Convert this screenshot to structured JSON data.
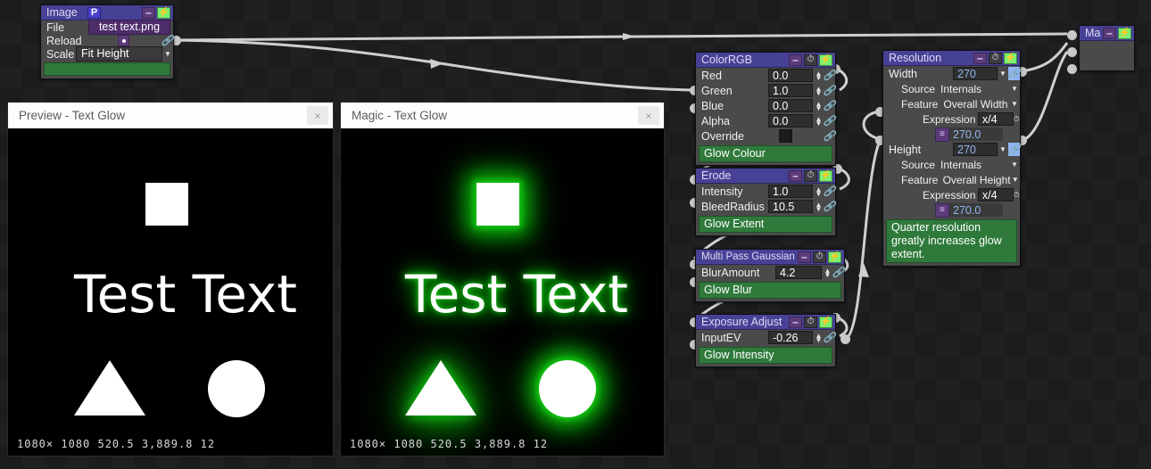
{
  "app": {
    "background_checker": "#1b1c1e"
  },
  "colors": {
    "node_header": "#474196",
    "node_body": "#4a4a4a",
    "comment_green": "#2f7a3b",
    "glow_green": "#12c312",
    "accent_purple": "#5b3b7a",
    "bolt_green": "#79f173",
    "link_active_blue": "#8fb4f2",
    "value_blue": "#93b7ef"
  },
  "nodes": {
    "image": {
      "title": "Image",
      "badge": "P",
      "header_buttons": [
        "minus",
        "bolt"
      ],
      "rows": [
        {
          "label": "File",
          "value": "test text.png",
          "type": "file"
        },
        {
          "label": "Reload",
          "value": "",
          "type": "radio"
        },
        {
          "label": "Scale",
          "value": "Fit Height",
          "type": "select"
        }
      ],
      "comment": ""
    },
    "colorrgb": {
      "title": "ColorRGB",
      "header_buttons": [
        "minus",
        "clock",
        "bolt"
      ],
      "rows": [
        {
          "label": "Red",
          "value": "0.0"
        },
        {
          "label": "Green",
          "value": "1.0"
        },
        {
          "label": "Blue",
          "value": "0.0"
        },
        {
          "label": "Alpha",
          "value": "0.0"
        },
        {
          "label": "Override",
          "value": "",
          "type": "checkbox"
        }
      ],
      "comment": "Glow Colour"
    },
    "erode": {
      "title": "Erode",
      "header_buttons": [
        "minus",
        "clock",
        "bolt"
      ],
      "rows": [
        {
          "label": "Intensity",
          "value": "1.0"
        },
        {
          "label": "BleedRadius",
          "value": "10.5"
        }
      ],
      "comment": "Glow Extent"
    },
    "blur": {
      "title": "Multi Pass Gaussian Blur",
      "header_buttons": [
        "minus",
        "clock",
        "bolt"
      ],
      "rows": [
        {
          "label": "BlurAmount",
          "value": "4.2"
        }
      ],
      "comment": "Glow Blur"
    },
    "exposure": {
      "title": "Exposure Adjust",
      "header_buttons": [
        "minus",
        "clock",
        "bolt"
      ],
      "rows": [
        {
          "label": "InputEV",
          "value": "-0.26"
        }
      ],
      "comment": "Glow Intensity"
    },
    "resolution": {
      "title": "Resolution",
      "header_buttons": [
        "minus",
        "clock",
        "bolt"
      ],
      "width": {
        "label": "Width",
        "value": "270",
        "source_label": "Source",
        "source_value": "Internals",
        "feature_label": "Feature",
        "feature_value": "Overall Width",
        "expression_label": "Expression",
        "expression_value": "x/4",
        "result_value": "270.0"
      },
      "height": {
        "label": "Height",
        "value": "270",
        "source_label": "Source",
        "source_value": "Internals",
        "feature_label": "Feature",
        "feature_value": "Overall Height",
        "expression_label": "Expression",
        "expression_value": "x/4",
        "result_value": "270.0"
      },
      "comment": "Quarter resolution greatly increases glow extent."
    },
    "magic": {
      "title": "Magic",
      "header_buttons": [
        "minus",
        "bolt"
      ]
    }
  },
  "previews": [
    {
      "title": "Preview - Text Glow",
      "close_label": "×",
      "status": "1080× 1080  520.5  3,889.8 12",
      "text": "Test Text",
      "glow": false
    },
    {
      "title": "Magic - Text Glow",
      "close_label": "×",
      "status": "1080× 1080  520.5  3,889.8 12",
      "text": "Test Text",
      "glow": true
    }
  ]
}
